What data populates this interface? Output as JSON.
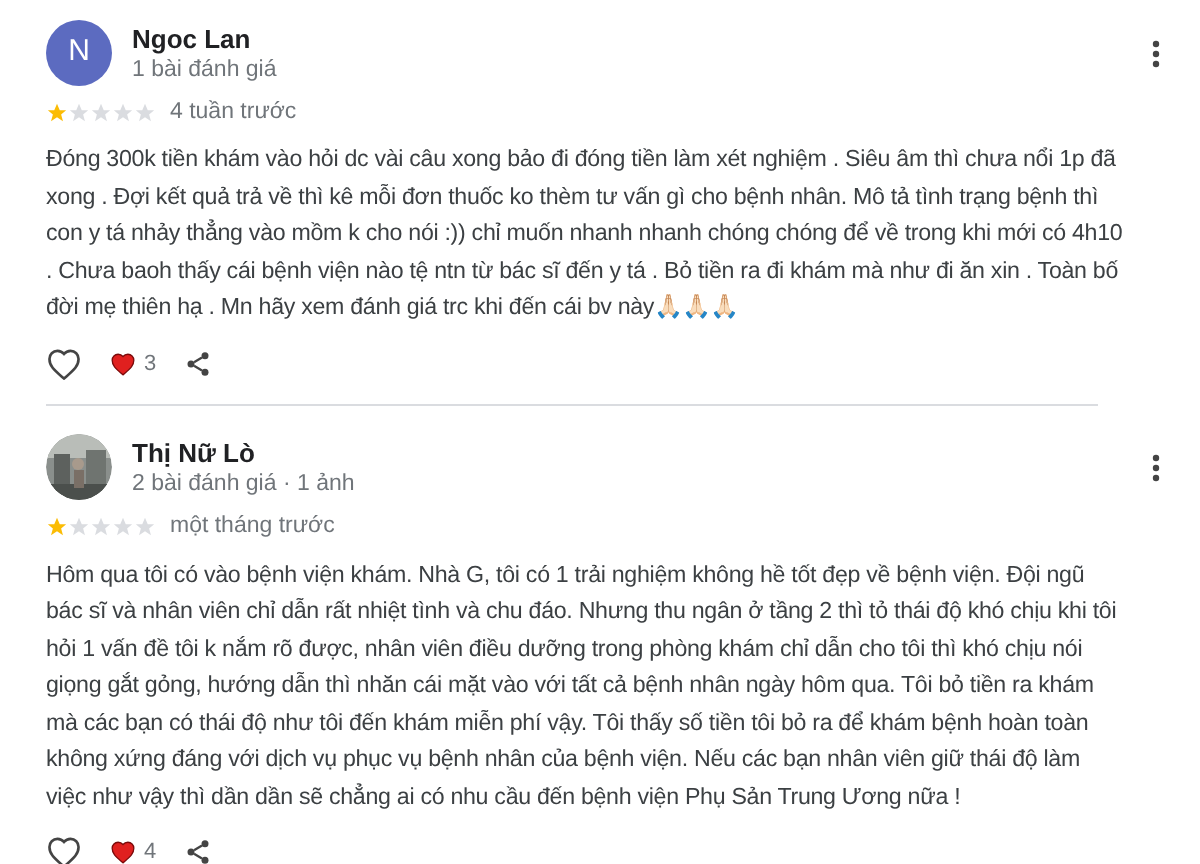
{
  "reviews": [
    {
      "avatar": {
        "kind": "letter",
        "letter": "N",
        "color": "#5c6bc0"
      },
      "name": "Ngoc Lan",
      "meta": "1 bài đánh giá",
      "stars": 1,
      "time": "4 tuần trước",
      "text": "Đóng 300k tiền khám vào hỏi dc vài câu xong bảo đi đóng tiền làm xét nghiệm . Siêu âm thì chưa nổi 1p đã xong . Đợi kết quả trả về thì kê mỗi đơn thuốc ko thèm tư vấn gì cho bệnh nhân. Mô tả tình trạng bệnh thì con y tá nhảy thẳng vào mồm k cho nói :)) chỉ muốn nhanh nhanh chóng chóng để về trong khi mới có 4h10 . Chưa baoh thấy cái bệnh viện nào tệ ntn từ bác sĩ đến y tá . Bỏ tiền ra đi khám mà như đi ăn xin . Toàn bố đời mẹ thiên hạ . Mn hãy xem đánh giá trc khi đến cái bv này🙏🏻🙏🏻🙏🏻",
      "reactions": "3"
    },
    {
      "name": "Thị Nữ Lò",
      "meta": "2 bài đánh giá · 1 ảnh",
      "stars": 1,
      "time": "một tháng trước",
      "text": "Hôm qua tôi có vào bệnh viện khám. Nhà G, tôi có 1 trải nghiệm không hề tốt đẹp về bệnh viện. Đội ngũ bác sĩ và nhân viên chỉ dẫn rất nhiệt tình và chu đáo. Nhưng thu ngân ở tầng 2 thì tỏ thái độ khó chịu khi tôi hỏi 1 vấn đề tôi k nắm rõ được, nhân viên điều dưỡng trong phòng khám chỉ dẫn cho tôi thì khó chịu nói giọng gắt gỏng, hướng dẫn thì nhăn cái mặt vào với tất cả bệnh nhân ngày hôm qua. Tôi bỏ tiền ra khám mà các bạn có thái độ như tôi đến khám miễn phí vậy. Tôi thấy số tiền tôi bỏ ra để khám bệnh hoàn toàn không xứng đáng với dịch vụ phục vụ bệnh nhân của bệnh viện. Nếu các bạn nhân viên giữ thái độ làm việc như vậy thì dần dần sẽ chẳng ai có nhu cầu đến bệnh viện Phụ Sản Trung Ương nữa !",
      "reactions": "4"
    }
  ]
}
